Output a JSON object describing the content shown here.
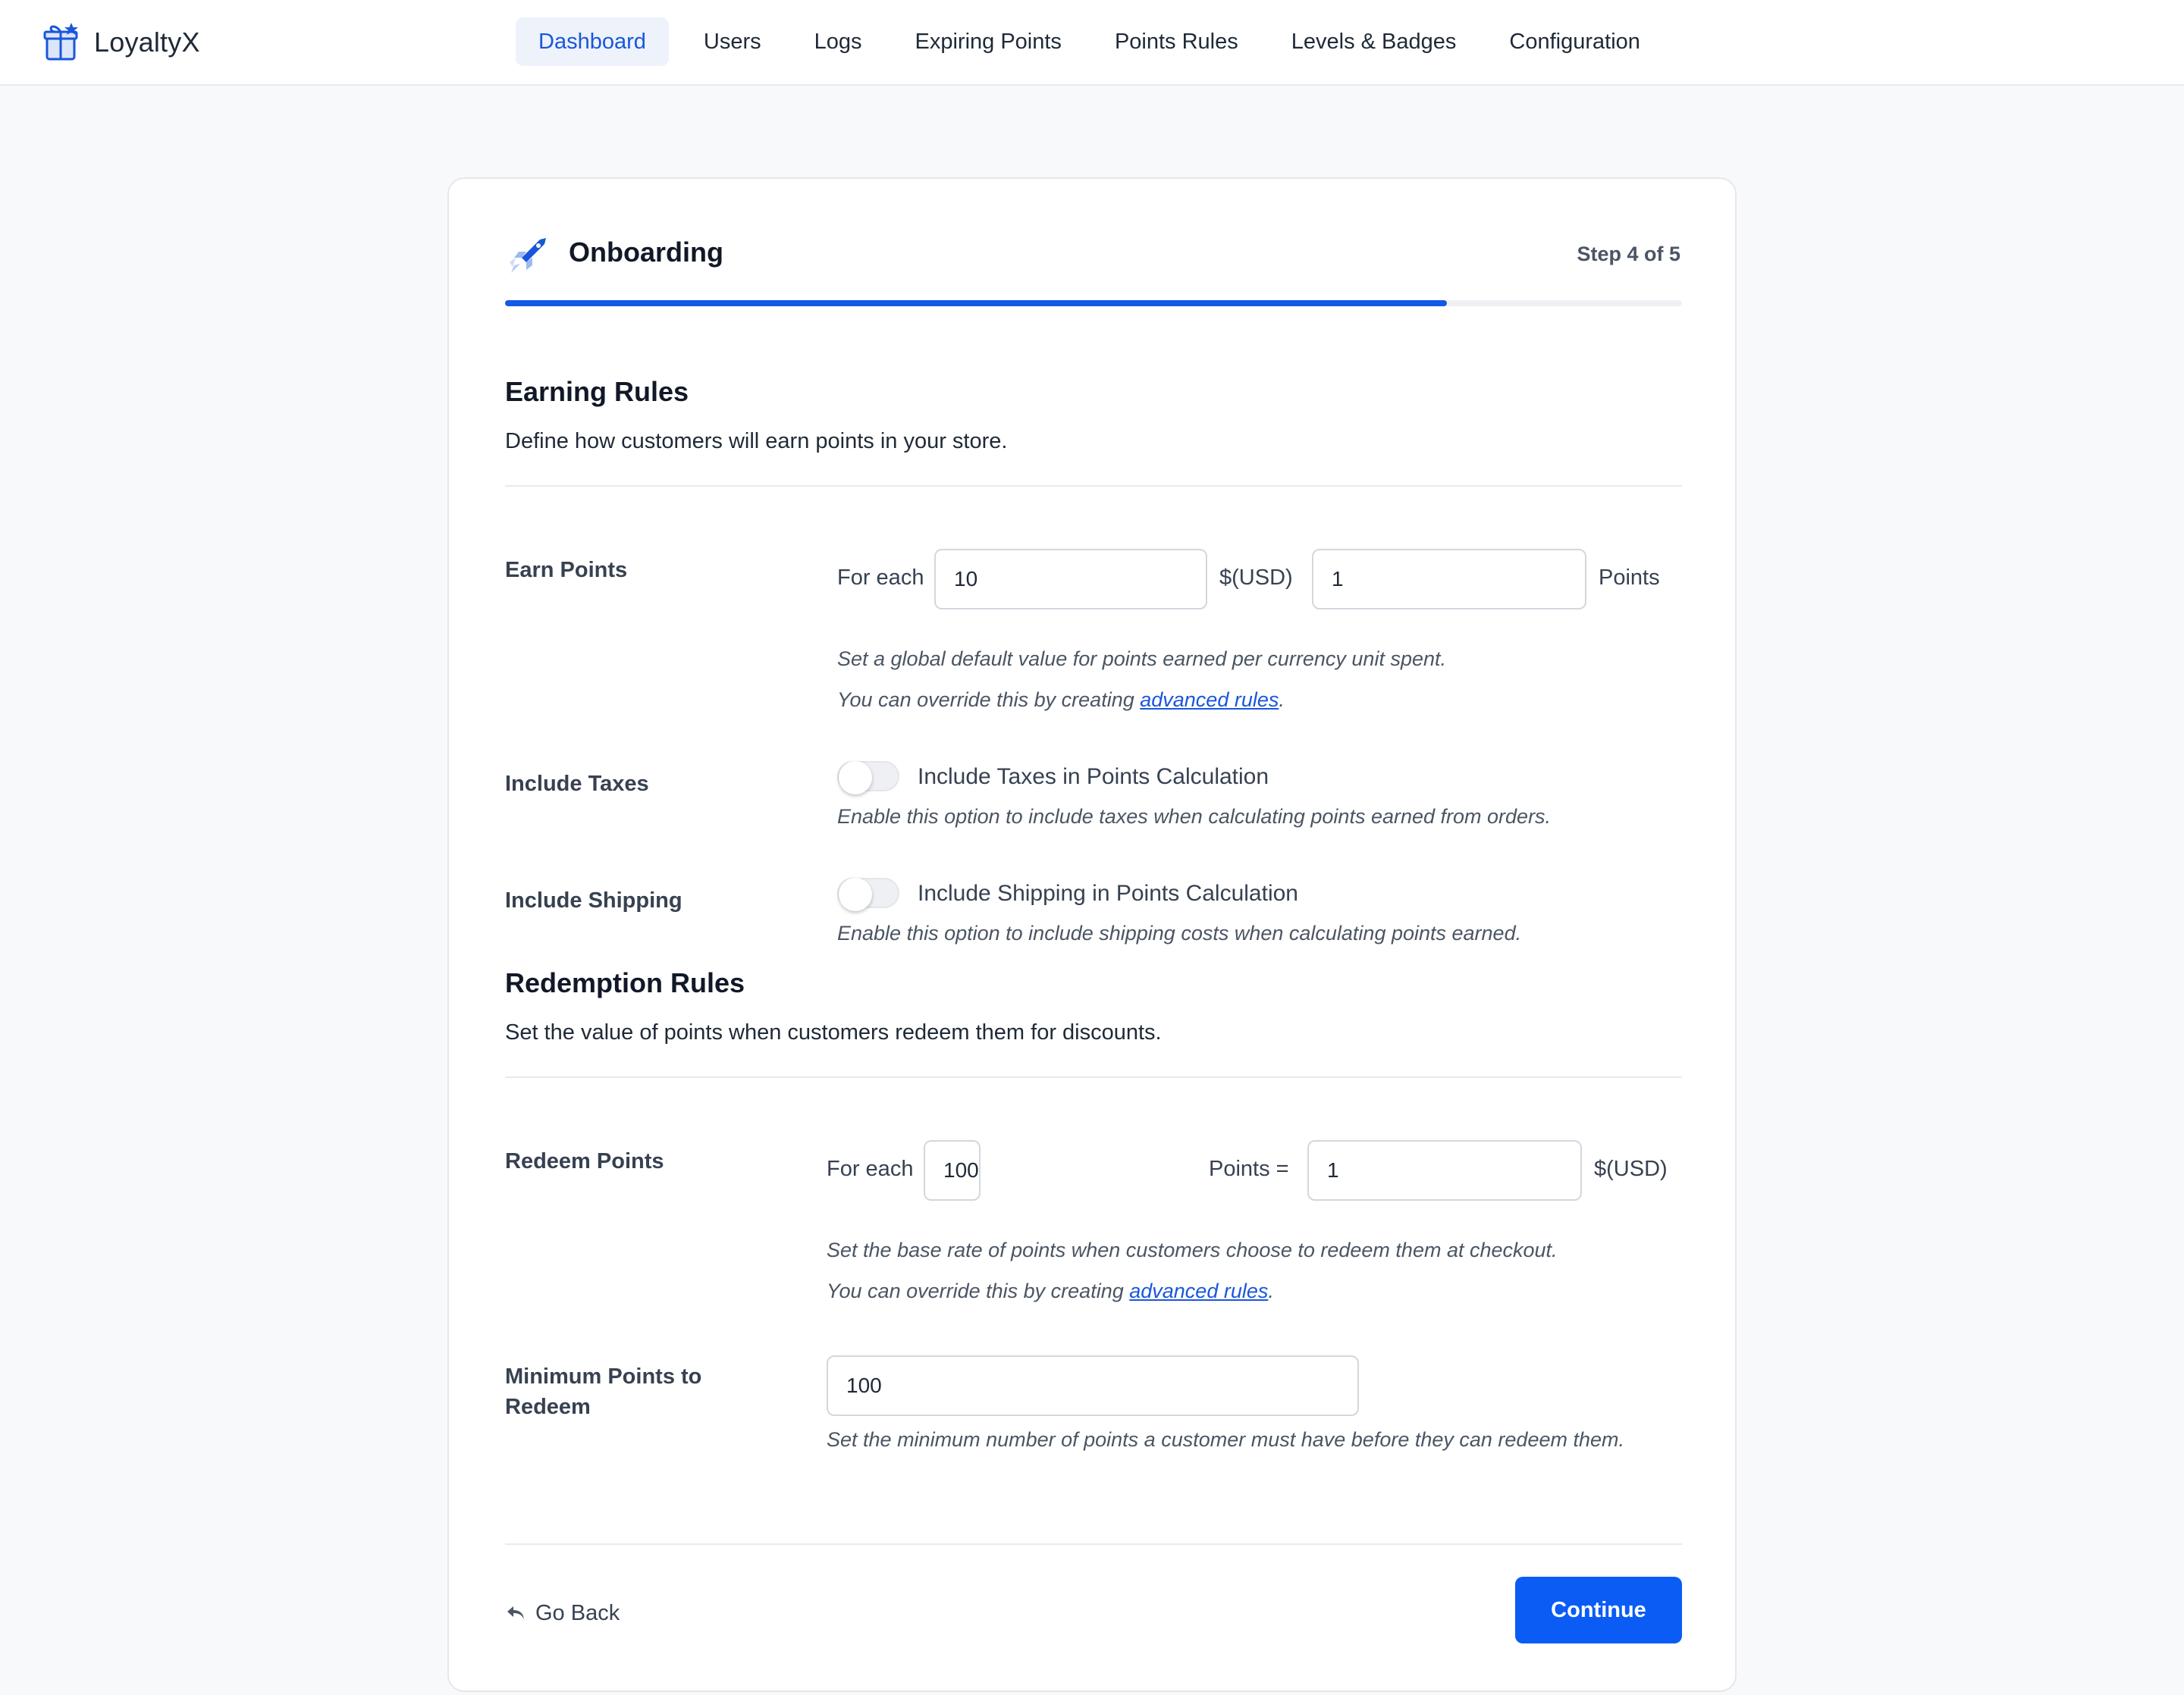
{
  "app": {
    "name": "LoyaltyX",
    "brand_icon": "gift-icon"
  },
  "nav": {
    "items": [
      {
        "label": "Dashboard",
        "active": true
      },
      {
        "label": "Users",
        "active": false
      },
      {
        "label": "Logs",
        "active": false
      },
      {
        "label": "Expiring Points",
        "active": false
      },
      {
        "label": "Points Rules",
        "active": false
      },
      {
        "label": "Levels & Badges",
        "active": false
      },
      {
        "label": "Configuration",
        "active": false
      }
    ]
  },
  "onboarding": {
    "title": "Onboarding",
    "icon": "rocket-icon",
    "step_text": "Step 4 of 5",
    "progress": 0.8
  },
  "earning": {
    "title": "Earning Rules",
    "description": "Define how customers will earn points in your store.",
    "earn_points": {
      "label": "Earn Points",
      "prefix": "For each",
      "amount_value": "10",
      "currency": "$(USD)",
      "points_value": "1",
      "suffix": "Points",
      "hint_line1": "Set a global default value for points earned per currency unit spent.",
      "hint_line2_pre": "You can override this by creating ",
      "hint_link": "advanced rules",
      "hint_line2_post": "."
    },
    "include_taxes": {
      "label": "Include Taxes",
      "toggle_label": "Include Taxes in Points Calculation",
      "enabled": false,
      "hint": "Enable this option to include taxes when calculating points earned from orders."
    },
    "include_shipping": {
      "label": "Include Shipping",
      "toggle_label": "Include Shipping in Points Calculation",
      "enabled": false,
      "hint": "Enable this option to include shipping costs when calculating points earned."
    }
  },
  "redemption": {
    "title": "Redemption Rules",
    "description": "Set the value of points when customers redeem them for discounts.",
    "redeem_points": {
      "label": "Redeem Points",
      "prefix": "For each",
      "points_value": "100",
      "middle": "Points =",
      "amount_value": "1",
      "currency": "$(USD)",
      "hint_line1": "Set the base rate of points when customers choose to redeem them at checkout.",
      "hint_line2_pre": "You can override this by creating ",
      "hint_link": "advanced rules",
      "hint_line2_post": "."
    },
    "minimum": {
      "label": "Minimum Points to Redeem",
      "value": "100",
      "hint": "Set the minimum number of points a customer must have before they can redeem them."
    }
  },
  "footer": {
    "back_label": "Go Back",
    "back_icon": "reply-arrow-icon",
    "continue_label": "Continue"
  },
  "colors": {
    "accent": "#1459e6",
    "button": "#0a5cf5",
    "nav_active_bg": "#edf2fb",
    "link": "#1a56db"
  }
}
